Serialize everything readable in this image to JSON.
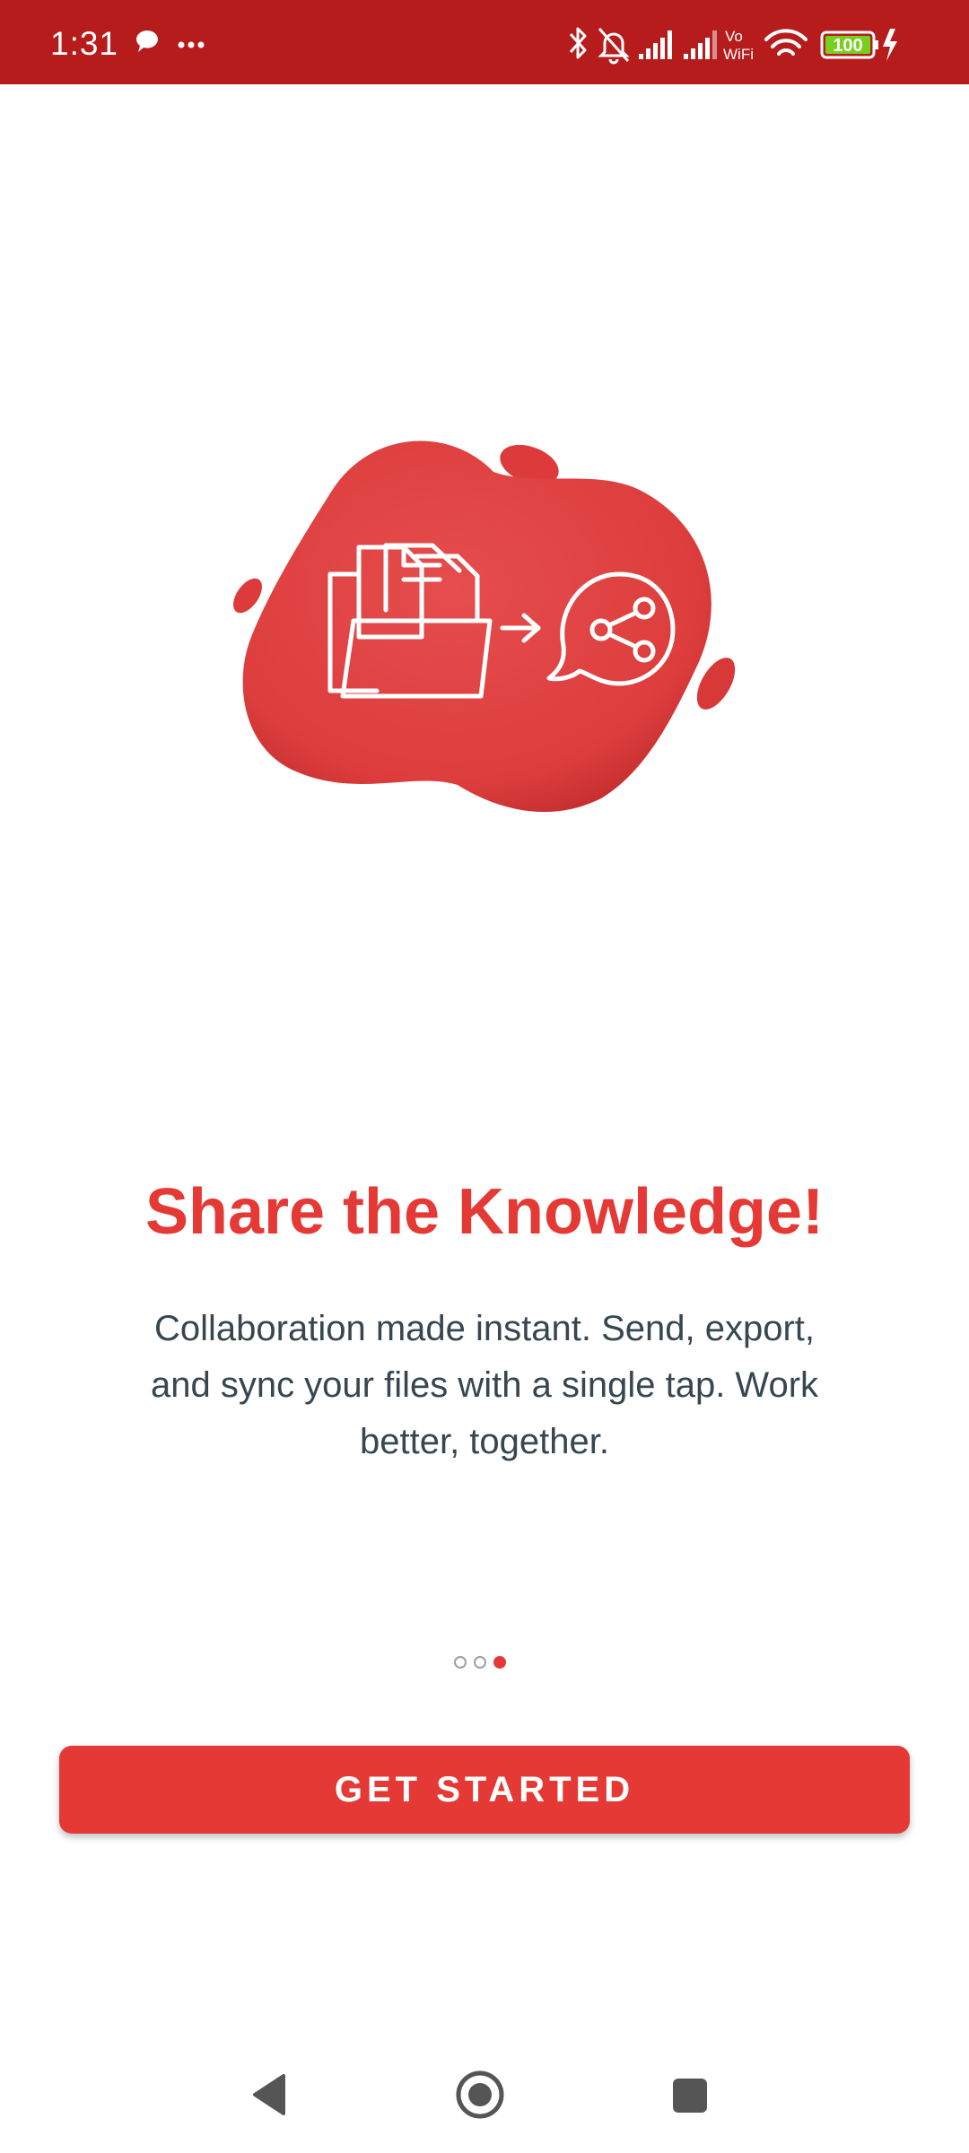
{
  "status_bar": {
    "time": "1:31",
    "battery_level": "100",
    "icons": [
      "chat-bubble-icon",
      "more-dots-icon",
      "bluetooth-icon",
      "bell-off-icon",
      "signal-icon",
      "signal-icon",
      "vowifi-icon",
      "wifi-icon",
      "battery-icon",
      "charging-icon"
    ],
    "vowifi_top": "Vo",
    "vowifi_bottom": "WiFi"
  },
  "onboarding": {
    "illustration": "folder-share-icon",
    "title": "Share the Knowledge!",
    "description": "Collaboration made instant. Send, export, and sync your files with a single tap. Work better, together.",
    "page_indicator": {
      "total": 3,
      "current": 3
    },
    "cta_label": "GET STARTED"
  },
  "nav_bar": {
    "buttons": [
      "back-icon",
      "home-icon",
      "recents-icon"
    ]
  },
  "colors": {
    "accent": "#e53935",
    "status_bar": "#b71c1c",
    "text": "#37474f",
    "battery_fill": "#76d11f"
  }
}
